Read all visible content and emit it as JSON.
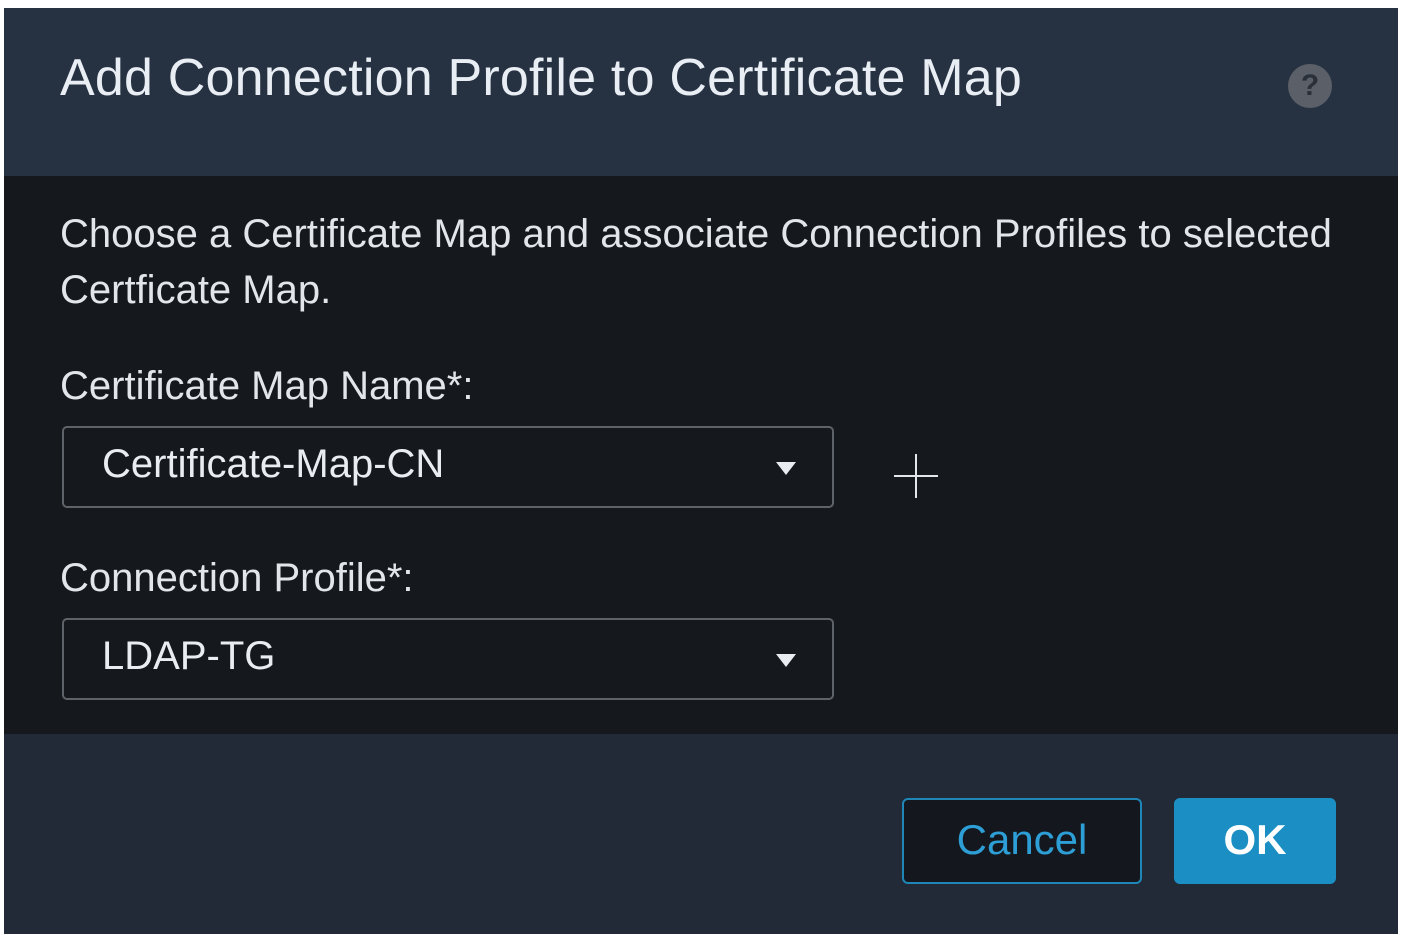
{
  "dialog": {
    "title": "Add Connection Profile to Certificate Map",
    "help_icon": "?",
    "description": "Choose a Certificate Map and associate Connection Profiles to selected Certficate Map."
  },
  "certificate_map": {
    "label": "Certificate Map Name*:",
    "selected": "Certificate-Map-CN"
  },
  "connection_profile": {
    "label": "Connection Profile*:",
    "selected": "LDAP-TG"
  },
  "footer": {
    "cancel_label": "Cancel",
    "ok_label": "OK"
  },
  "icons": {
    "help": "help-icon",
    "dropdown": "chevron-down-icon",
    "add": "plus-icon"
  },
  "colors": {
    "header_bg": "#263242",
    "body_bg": "#15181d",
    "accent": "#1b8fc3"
  }
}
